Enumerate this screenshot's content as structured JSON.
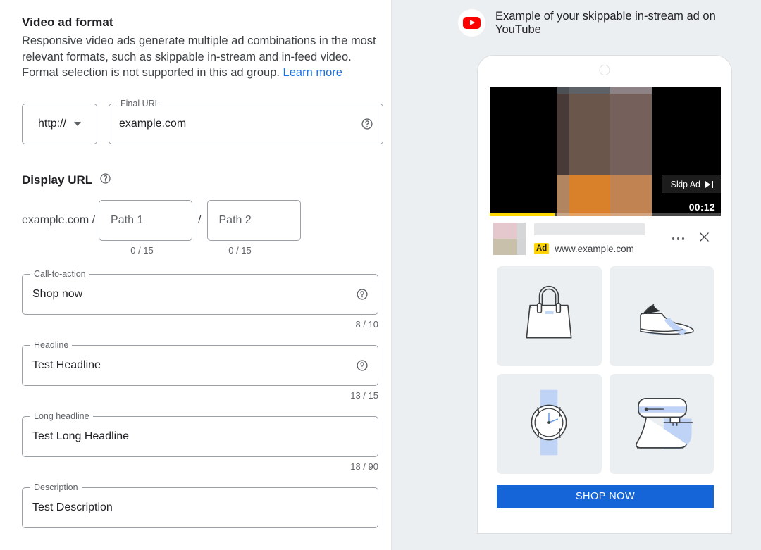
{
  "left": {
    "section_title": "Video ad format",
    "section_desc_part1": "Responsive video ads generate multiple ad combinations in the most relevant formats, such as skippable in-stream and in-feed video. Format selection is not supported in this ad group. ",
    "learn_more": "Learn more",
    "protocol": {
      "value": "http://",
      "icon": "chevron-down-icon"
    },
    "final_url": {
      "legend": "Final URL",
      "value": "example.com",
      "help_icon": "help-circle-icon"
    },
    "display_url": {
      "label": "Display URL",
      "help_icon": "help-circle-icon",
      "domain_prefix": "example.com /",
      "separator": "/",
      "path1_placeholder": "Path 1",
      "path2_placeholder": "Path 2",
      "path1_counter": "0 / 15",
      "path2_counter": "0 / 15"
    },
    "fields": [
      {
        "legend": "Call-to-action",
        "value": "Shop now",
        "counter": "8 / 10",
        "has_help": true
      },
      {
        "legend": "Headline",
        "value": "Test Headline",
        "counter": "13 / 15",
        "has_help": true
      },
      {
        "legend": "Long headline",
        "value": "Test Long Headline",
        "counter": "18 / 90",
        "has_help": false
      },
      {
        "legend": "Description",
        "value": "Test Description",
        "counter": "",
        "has_help": false
      }
    ]
  },
  "preview": {
    "header_icon": "youtube-logo-icon",
    "header_text": "Example of your skippable in-stream ad on YouTube",
    "video": {
      "skip_label": "Skip Ad",
      "skip_icon": "skip-next-icon",
      "timer": "00:12",
      "progress_percent": 28,
      "block_colors": [
        "#4c5054",
        "#5e6165",
        "#8d8286",
        "#483a36",
        "#6b564c",
        "#75605b",
        "#b08560",
        "#d9802a",
        "#c08351",
        "#7e87a0",
        "#5b5e6b",
        "#3e434c"
      ],
      "letterbox_color": "#000000",
      "progress_color": "#ffd600"
    },
    "ad_bar": {
      "avatar_colors": [
        "#e4c8ce",
        "#d5d6d8",
        "#c9c0ab",
        "#d3d4d6"
      ],
      "ad_badge": "Ad",
      "ad_url": "www.example.com",
      "more_icon": "more-horizontal-icon",
      "close_icon": "close-icon"
    },
    "products": [
      {
        "name": "handbag-product",
        "icon": "handbag-icon"
      },
      {
        "name": "sneaker-product",
        "icon": "sneaker-icon"
      },
      {
        "name": "watch-product",
        "icon": "watch-icon"
      },
      {
        "name": "stand-mixer-product",
        "icon": "stand-mixer-icon"
      }
    ],
    "cta_button": "SHOP NOW"
  },
  "colors": {
    "accent_blue": "#1a73e8",
    "cta_blue": "#1565d8",
    "youtube_red": "#ff0000",
    "ad_yellow": "#ffd400",
    "panel_bg": "#eceff1"
  }
}
